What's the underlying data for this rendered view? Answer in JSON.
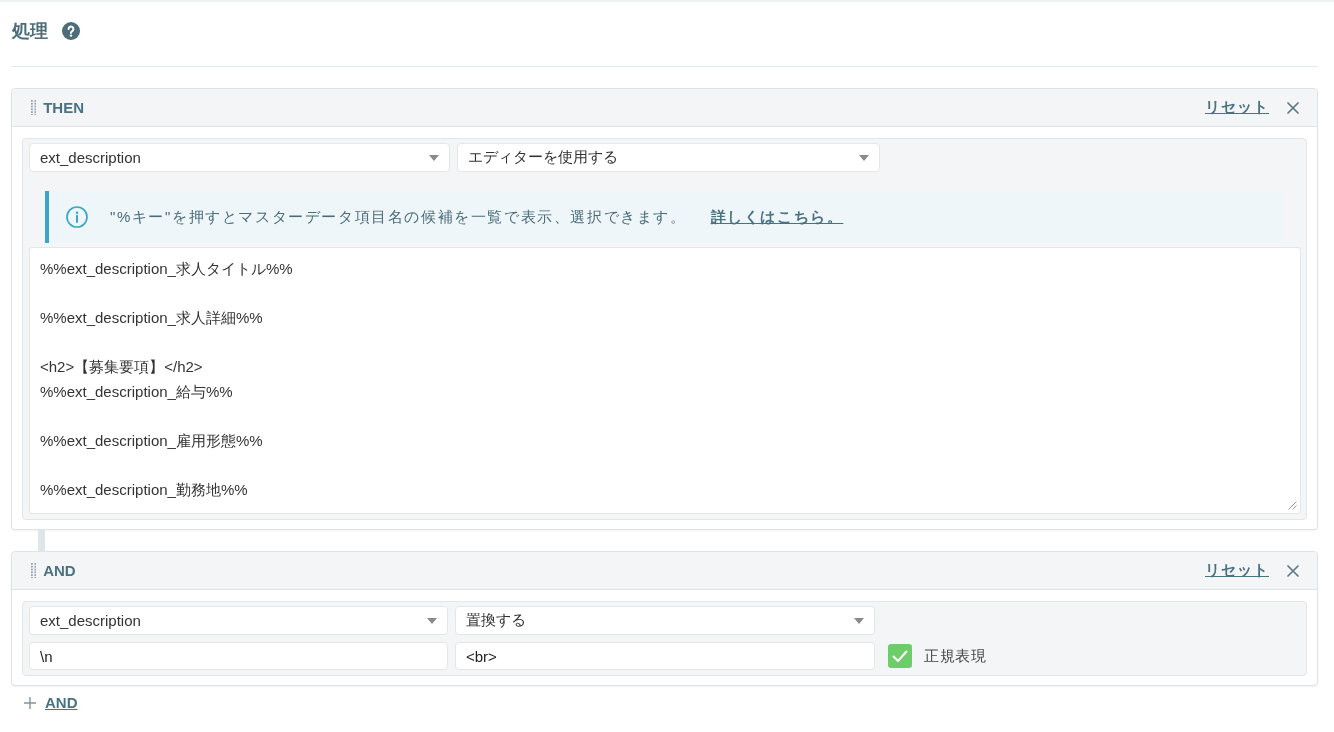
{
  "section": {
    "title": "処理"
  },
  "blocks": [
    {
      "kind": "editor",
      "label": "THEN",
      "reset_link": "リセット",
      "field_select": "ext_description",
      "action_select": "エディターを使用する",
      "info": {
        "text": "\"%キー\"を押すとマスターデータ項目名の候補を一覧で表示、選択できます。",
        "link": "詳しくはこちら。"
      },
      "editor": {
        "value": "%%ext_description_求人タイトル%%\n\n%%ext_description_求人詳細%%\n\n<h2>【募集要項】</h2>\n%%ext_description_給与%%\n\n%%ext_description_雇用形態%%\n\n%%ext_description_勤務地%%"
      }
    },
    {
      "kind": "replace",
      "label": "AND",
      "reset_link": "リセット",
      "field_select": "ext_description",
      "action_select": "置換する",
      "search_field": {
        "value": "\\n"
      },
      "replace_field": {
        "value": "<br>"
      },
      "regex": {
        "label": "正規表現",
        "checked": true
      }
    }
  ],
  "add_button": {
    "label": "AND"
  }
}
